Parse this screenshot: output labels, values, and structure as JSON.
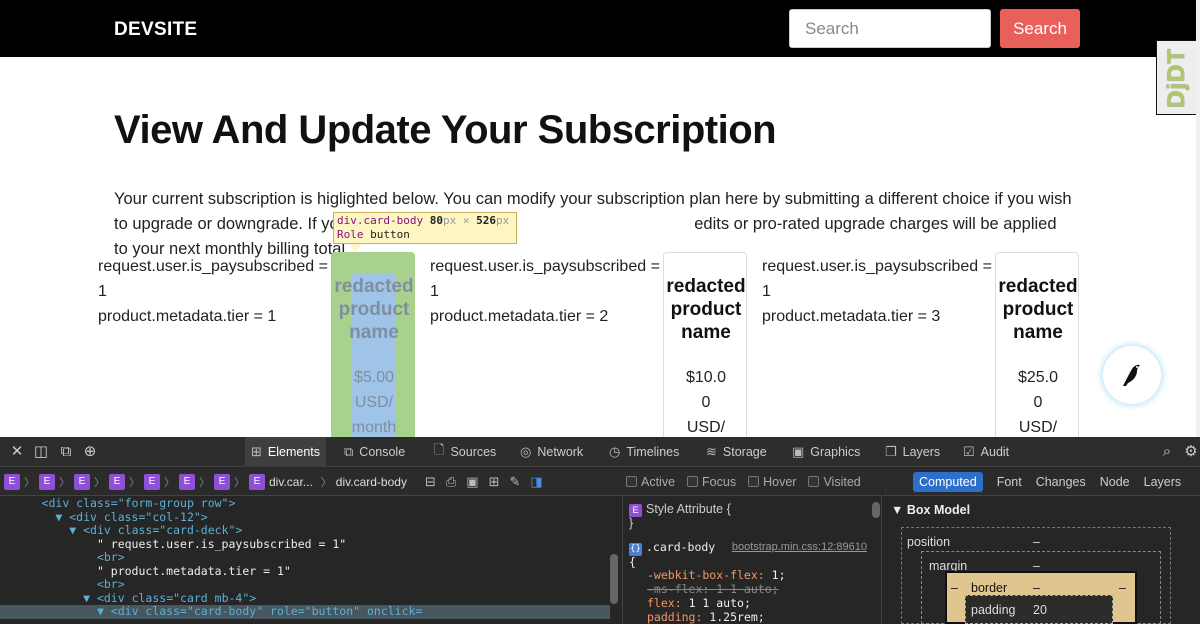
{
  "navbar": {
    "brand": "DEVSITE",
    "search_placeholder": "Search",
    "search_button": "Search"
  },
  "djdt_label": "DjDT",
  "page": {
    "title": "View And Update Your Subscription",
    "intro_before": "Your current subscription is higlighted below. You can modify your subscription plan here by submitting a different choice if you wish to upgrade or downgrade. If you change to a diffe",
    "intro_after": "edits or pro-rated upgrade charges will be applied to your next monthly billing total."
  },
  "plans": [
    {
      "meta_line1": "request.user.is_paysubscribed = 1",
      "meta_line2": "product.metadata.tier = 1",
      "name_lines": [
        "redacted",
        "product",
        "name"
      ],
      "price_lines": [
        "$5.00",
        "USD/",
        "month"
      ]
    },
    {
      "meta_line1": "request.user.is_paysubscribed = 1",
      "meta_line2": "product.metadata.tier = 2",
      "name_lines": [
        "redacted",
        "product",
        "name"
      ],
      "price_lines": [
        "$10.0",
        "0",
        "USD/"
      ]
    },
    {
      "meta_line1": "request.user.is_paysubscribed = 1",
      "meta_line2": "product.metadata.tier = 3",
      "name_lines": [
        "redacted",
        "product",
        "name"
      ],
      "price_lines": [
        "$25.0",
        "0",
        "USD/"
      ]
    }
  ],
  "inspect_tooltip": {
    "selector": "div.card-body",
    "width": "80",
    "height": "526",
    "unit": "px",
    "times": "×",
    "role_label": "Role",
    "role_value": "button"
  },
  "devtools": {
    "tabs": [
      {
        "label": "Elements",
        "icon": "elements-icon",
        "glyph": "⊞"
      },
      {
        "label": "Console",
        "icon": "console-icon",
        "glyph": "⧉"
      },
      {
        "label": "Sources",
        "icon": "sources-icon",
        "glyph": "🗋"
      },
      {
        "label": "Network",
        "icon": "network-icon",
        "glyph": "◎"
      },
      {
        "label": "Timelines",
        "icon": "timelines-icon",
        "glyph": "◷"
      },
      {
        "label": "Storage",
        "icon": "storage-icon",
        "glyph": "≋"
      },
      {
        "label": "Graphics",
        "icon": "graphics-icon",
        "glyph": "▣"
      },
      {
        "label": "Layers",
        "icon": "layers-icon",
        "glyph": "❐"
      },
      {
        "label": "Audit",
        "icon": "audit-icon",
        "glyph": "☑"
      }
    ],
    "breadcrumbs": {
      "element_badge": "E",
      "crumb1": "div.car...",
      "crumb2": "div.card-body"
    },
    "dom_lines": [
      {
        "indent": "      ",
        "tri": "",
        "text": "<div class=\"form-group row\">"
      },
      {
        "indent": "        ",
        "tri": "▼ ",
        "text": "<div class=\"col-12\">"
      },
      {
        "indent": "          ",
        "tri": "▼ ",
        "text": "<div class=\"card-deck\">"
      },
      {
        "indent": "              ",
        "tri": "",
        "text": "\" request.user.is_paysubscribed = 1\""
      },
      {
        "indent": "              ",
        "tri": "",
        "text": "<br>"
      },
      {
        "indent": "              ",
        "tri": "",
        "text": "\" product.metadata.tier = 1\""
      },
      {
        "indent": "              ",
        "tri": "",
        "text": "<br>"
      },
      {
        "indent": "            ",
        "tri": "▼ ",
        "text": "<div class=\"card mb-4\">"
      },
      {
        "indent": "              ",
        "tri": "▼ ",
        "text": "<div class=\"card-body\" role=\"button\" onclick="
      }
    ],
    "states": [
      "Active",
      "Focus",
      "Hover",
      "Visited"
    ],
    "style_attribute": "Style Attribute",
    "style_attribute_open": "{",
    "style_attribute_close": "}",
    "rule": {
      "selector": ".card-body",
      "source": "bootstrap.min.css:12:89610",
      "open_brace": "{",
      "props": [
        {
          "name": "-webkit-box-flex",
          "value": "1;",
          "strike": false
        },
        {
          "name": "-ms-flex",
          "value": "1 1 auto;",
          "strike": true
        },
        {
          "name": "flex",
          "value": "1 1 auto;",
          "strike": false
        },
        {
          "name": "padding",
          "value": "1.25rem;",
          "strike": false
        }
      ]
    },
    "side_tabs": [
      "Computed",
      "Font",
      "Changes",
      "Node",
      "Layers"
    ],
    "box_model": {
      "title": "Box Model",
      "position": "position",
      "margin": "margin",
      "border": "border",
      "padding": "padding",
      "dash": "–",
      "padding_value": "20"
    }
  },
  "colors": {
    "navbar_bg": "#000000",
    "search_button_bg": "#e95f5a",
    "highlight_card_green": "#a9d18e",
    "highlight_card_blue": "#9fc4e8",
    "devtools_bg": "#262626"
  }
}
